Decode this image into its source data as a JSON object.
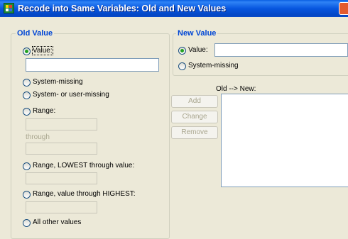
{
  "window": {
    "title": "Recode into Same Variables: Old and New Values"
  },
  "old_value": {
    "legend": "Old Value",
    "value_label": "Value:",
    "value_input": "",
    "system_missing_label": "System-missing",
    "system_or_user_missing_label": "System- or user-missing",
    "range_label": "Range:",
    "range_from": "",
    "through_label": "through",
    "range_to": "",
    "range_lowest_label": "Range, LOWEST through value:",
    "range_lowest_value": "",
    "range_highest_label": "Range, value through HIGHEST:",
    "range_highest_value": "",
    "all_other_label": "All other values",
    "selected": "value"
  },
  "new_value": {
    "legend": "New Value",
    "value_label": "Value:",
    "value_input": "",
    "system_missing_label": "System-missing",
    "selected": "value"
  },
  "mapping": {
    "list_label": "Old --> New:",
    "items": [],
    "add_label": "Add",
    "change_label": "Change",
    "remove_label": "Remove"
  }
}
